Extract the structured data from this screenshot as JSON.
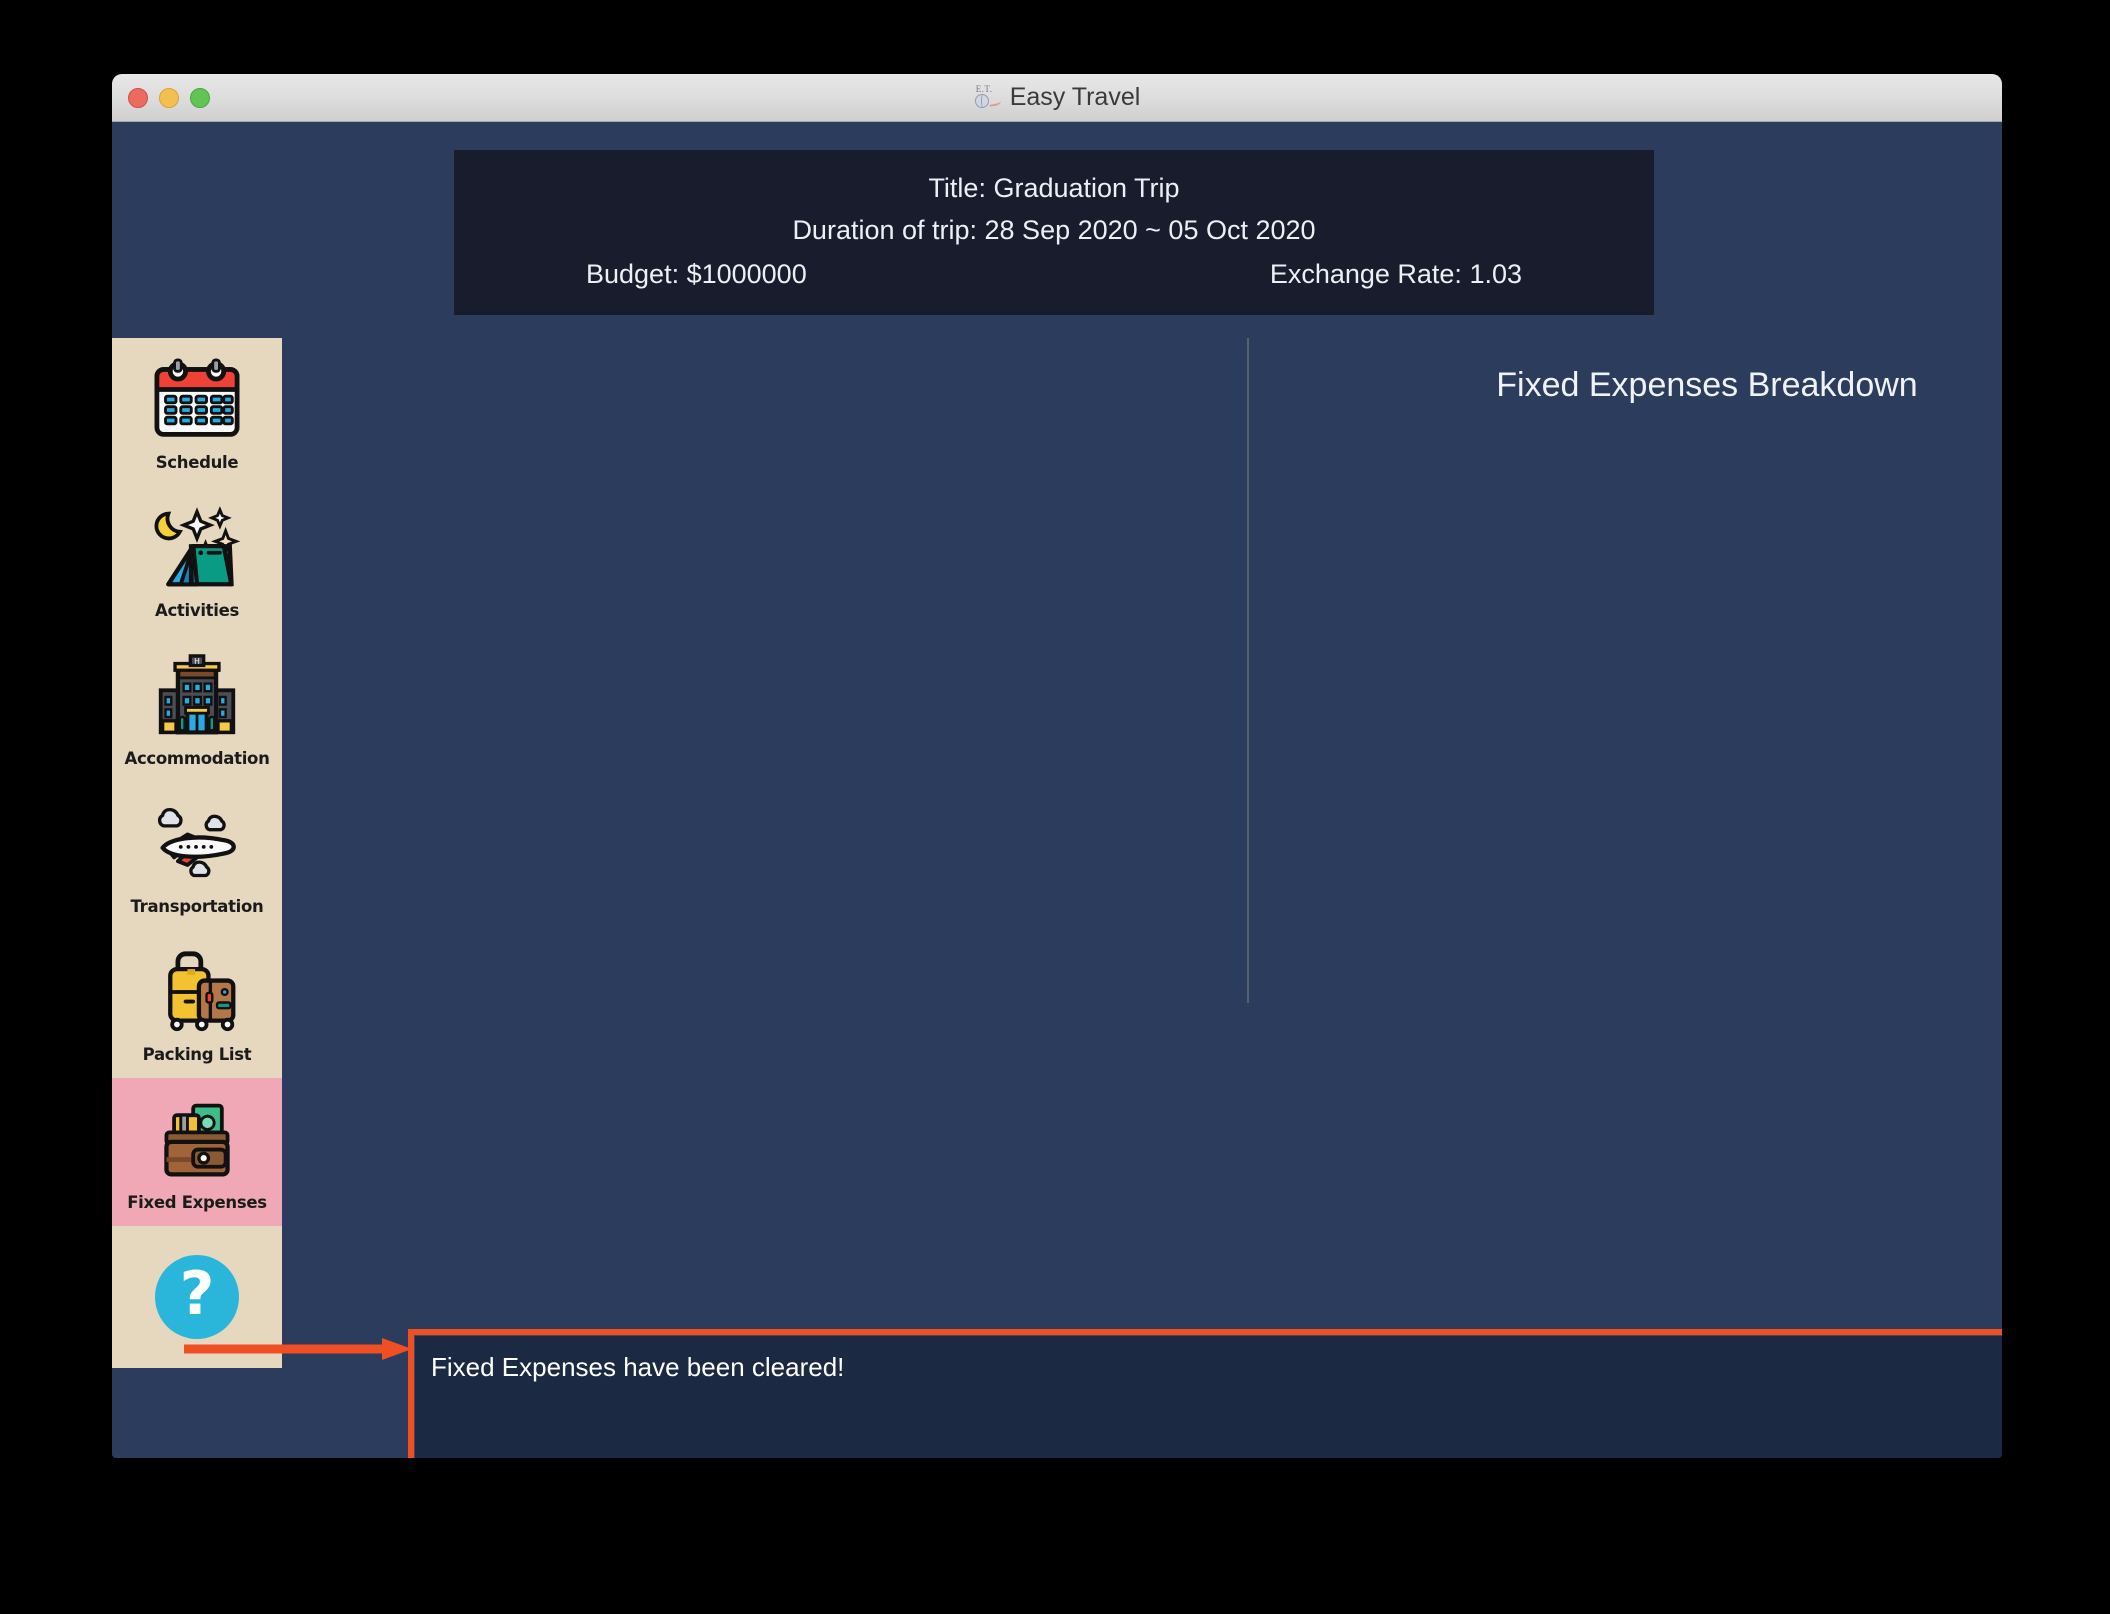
{
  "window": {
    "title": "Easy Travel",
    "app_icon": "easy-travel-globe-icon",
    "traffic_lights": {
      "close_color": "#ec6a5f",
      "minimize_color": "#f5bf4f",
      "maximize_color": "#61c454"
    }
  },
  "trip_info": {
    "title_line": "Title: Graduation Trip",
    "duration_line": "Duration of trip: 28 Sep 2020 ~ 05 Oct 2020",
    "budget_label": "Budget: $1000000",
    "exchange_rate_label": "Exchange Rate: 1.03"
  },
  "sidebar": {
    "background_color": "#e6d7bf",
    "selected_color": "#f0a8b6",
    "items": [
      {
        "label": "Schedule",
        "icon": "calendar-icon",
        "selected": false
      },
      {
        "label": "Activities",
        "icon": "tent-night-icon",
        "selected": false
      },
      {
        "label": "Accommodation",
        "icon": "hotel-icon",
        "selected": false
      },
      {
        "label": "Transportation",
        "icon": "airplane-icon",
        "selected": false
      },
      {
        "label": "Packing List",
        "icon": "luggage-icon",
        "selected": false
      },
      {
        "label": "Fixed Expenses",
        "icon": "wallet-money-icon",
        "selected": true
      }
    ],
    "help": {
      "label": "?",
      "icon": "question-mark-icon",
      "color": "#29b6da"
    }
  },
  "main": {
    "breakdown_title": "Fixed Expenses Breakdown",
    "chart_empty": true
  },
  "message_log": {
    "text": "Fixed Expenses have been cleared!",
    "highlight_color": "#f04e23"
  },
  "command_input": {
    "value": "",
    "placeholder": ""
  },
  "chart_data": {
    "type": "pie",
    "title": "Fixed Expenses Breakdown",
    "categories": [],
    "values": [],
    "xlabel": "",
    "ylabel": "",
    "legend_position": "none",
    "note": "Chart area is empty — fixed expenses have been cleared"
  }
}
